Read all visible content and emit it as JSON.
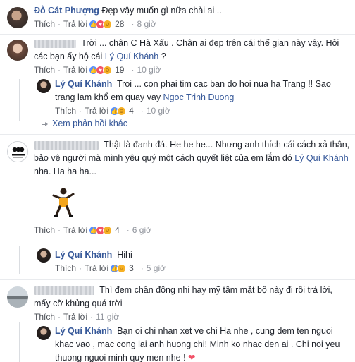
{
  "actions": {
    "like_label": "Thích",
    "reply_label": "Trả lời"
  },
  "comments": [
    {
      "author": "Đỗ Cát Phượng",
      "text": "Đẹp vậy muốn gì nữa chài ai ..",
      "reactions": [
        "like",
        "love",
        "haha"
      ],
      "count": "28",
      "time": "8 giờ"
    },
    {
      "author_hidden": true,
      "text": "Trời ... chân C Hà Xấu . Chân ai đẹp trên cái thế gian này vậy. Hỏi các bạn ấy hộ cái ",
      "mention": "Lý Quí Khánh",
      "text_end": " ?",
      "reactions": [
        "like",
        "love",
        "haha"
      ],
      "count": "19",
      "time": "10 giờ"
    },
    {
      "author": "Lý Quí Khánh",
      "text": "Troi ... con phai tim cac ban do hoi nua ha Trang !! Sao trang lam khổ em quay vay ",
      "mention": "Ngoc Trinh Duong",
      "reactions": [
        "like",
        "haha"
      ],
      "count": "4",
      "time": "10 giờ"
    },
    {
      "more_replies": "Xem phản hồi khác"
    },
    {
      "author_hidden": true,
      "text": "Thật là đanh đá. He he he... Nhưng anh thích cái cách xả thân, bảo vệ người mà mình yêu quý một cách quyết liệt của em lắm đó ",
      "mention": "Lý Quí Khánh",
      "text_end": " nha. Ha ha ha...",
      "reactions": [
        "like",
        "love",
        "haha"
      ],
      "count": "4",
      "time": "6 giờ"
    },
    {
      "author": "Lý Quí Khánh",
      "text": "Hihi",
      "reactions": [
        "like",
        "haha"
      ],
      "count": "3",
      "time": "5 giờ"
    },
    {
      "author_hidden": true,
      "text": "Thì đem chân đông nhi hay mỹ tâm mặt bộ này đi rồi trả lời, mấy cỡ khủng quá trời",
      "time": "11 giờ"
    },
    {
      "author": "Lý Quí Khánh",
      "text": "Bạn oi chi nhan xet ve chi Ha nhe , cung dem ten nguoi khac vao , mac cong lai anh huong chi! Minh ko nhac den ai . Chi noi yeu thuong nguoi minh quy men nhe !",
      "heart": "❤"
    }
  ],
  "colors": {
    "link": "#365899",
    "text": "#1d2129",
    "meta": "#90949c",
    "heart": "#f25268"
  },
  "icons": [
    "like-reaction-icon",
    "love-reaction-icon",
    "haha-reaction-icon",
    "reply-arrow-icon",
    "heart-emoji-icon"
  ]
}
